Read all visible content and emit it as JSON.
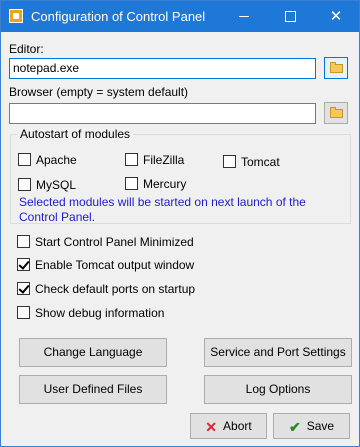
{
  "window": {
    "title": "Configuration of Control Panel"
  },
  "editor": {
    "label": "Editor:",
    "value": "notepad.exe"
  },
  "browser": {
    "label": "Browser (empty = system default)",
    "value": ""
  },
  "autostart": {
    "legend": "Autostart of modules",
    "modules": [
      {
        "label": "Apache",
        "checked": false
      },
      {
        "label": "FileZilla",
        "checked": false
      },
      {
        "label": "Tomcat",
        "checked": false
      },
      {
        "label": "MySQL",
        "checked": false
      },
      {
        "label": "Mercury",
        "checked": false
      }
    ],
    "note": "Selected modules will be started on next launch of the Control Panel.",
    "note_color": "#1c1cd0"
  },
  "options": [
    {
      "label": "Start Control Panel Minimized",
      "checked": false
    },
    {
      "label": "Enable Tomcat output window",
      "checked": true
    },
    {
      "label": "Check default ports on startup",
      "checked": true
    },
    {
      "label": "Show debug information",
      "checked": false
    }
  ],
  "buttons": {
    "change_language": "Change Language",
    "service_port": "Service and Port Settings",
    "user_files": "User Defined Files",
    "log_options": "Log Options",
    "abort": "Abort",
    "save": "Save"
  },
  "colors": {
    "titlebar": "#1e78d7",
    "accent": "#0078d7"
  },
  "icons": {
    "app": "xampp-icon",
    "folder": "folder-icon",
    "abort": "x-icon",
    "save": "check-icon"
  }
}
